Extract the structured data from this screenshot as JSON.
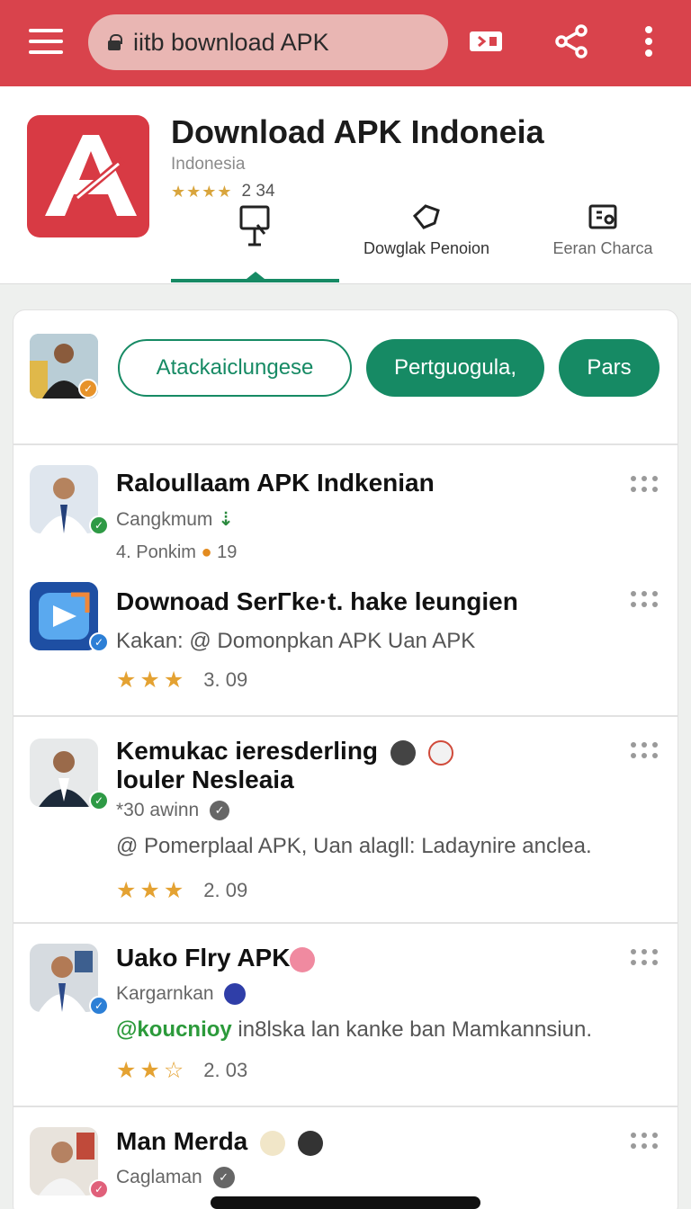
{
  "browser": {
    "url_text": "iitb bownload APK",
    "icons": [
      "menu-icon",
      "lock-icon",
      "cast-icon",
      "share-icon",
      "more-vert-icon"
    ]
  },
  "app": {
    "title": "Download APK Indoneia",
    "subtitle": "Indonesia",
    "rating_stars": "★★★★",
    "rating_count": "2 34",
    "tabs": [
      {
        "label": "",
        "icon": "kiosk-icon"
      },
      {
        "label": "Dowglak Penoion",
        "icon": "tag-icon"
      },
      {
        "label": "Eeran Charca",
        "icon": "grid-box-icon"
      }
    ],
    "accent": "#168a64",
    "brand_red": "#d9434c"
  },
  "filters": {
    "chips": [
      "Atackaiclungese",
      "Pertguogula,",
      "Pars"
    ]
  },
  "listings": [
    {
      "title": "Raloullaam APK Indkenian",
      "meta": "Cangkmum",
      "extra": "4. Ponkim",
      "rating_value": "19",
      "verified_color": "#2e9a45"
    },
    {
      "title": "Downoad SerГke·t. hake leungien",
      "desc": "Kakan: @ Domonpkan APK Uan APK",
      "stars": "★★★",
      "rating_value": "3. 09",
      "verified_color": "#2c7fd6"
    },
    {
      "title_line1": "Kemukac ieresderling",
      "title_line2": "louler Nesleaia",
      "meta": "*30 awinn",
      "desc": "@ Pomerplaal APK, Uan alagll: Ladaynire anclea.",
      "stars": "★★★",
      "rating_value": "2. 09",
      "verified_color": "#2e9a45"
    },
    {
      "title": "Uako Flry APK",
      "meta": "Kargarnkan",
      "desc_link": "@koucnioy",
      "desc_rest": " in8lska lan kanke ban Mamkannsiun.",
      "stars": "★★☆",
      "rating_value": "2. 03",
      "verified_color": "#2c7fd6"
    },
    {
      "title": "Man Merda",
      "meta": "Caglaman",
      "verified_color": "#e0607a"
    }
  ]
}
